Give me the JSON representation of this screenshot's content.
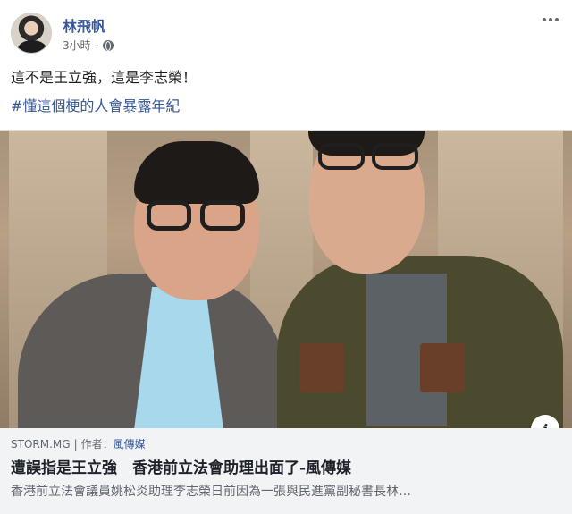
{
  "post": {
    "author": "林飛帆",
    "time": "3小時",
    "dot": "·",
    "privacy_icon": "globe-icon",
    "more_icon": "more-horizontal-icon",
    "text": "這不是王立強，這是李志榮！",
    "hashtag": "#懂這個梗的人會暴露年紀"
  },
  "link_preview": {
    "source": "STORM.MG",
    "separator": "|",
    "author_label": "作者：",
    "author": "風傳媒",
    "info_icon": "i",
    "title": "遭誤指是王立強　香港前立法會助理出面了-風傳媒",
    "description": "香港前立法會議員姚松炎助理李志榮日前因為一張與民進黨副秘書長林…"
  },
  "colors": {
    "link_blue": "#385898",
    "meta_gray": "#606770",
    "caption_bg": "#f2f3f5"
  }
}
